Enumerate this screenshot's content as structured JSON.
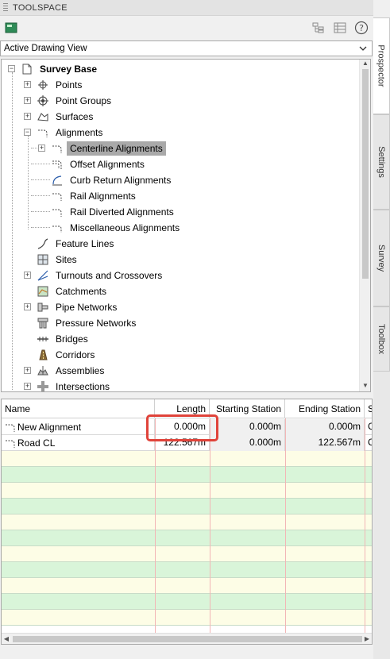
{
  "window": {
    "title": "TOOLSPACE"
  },
  "toolbar": {
    "left_icon": "prospector-icon",
    "right_icons": [
      "item-view-icon",
      "list-view-icon",
      "help-icon"
    ]
  },
  "view_selector": {
    "value": "Active Drawing View"
  },
  "tree": {
    "root": "Survey Base",
    "items": [
      {
        "label": "Points",
        "icon": "points-icon"
      },
      {
        "label": "Point Groups",
        "icon": "point-groups-icon"
      },
      {
        "label": "Surfaces",
        "icon": "surfaces-icon"
      },
      {
        "label": "Alignments",
        "icon": "alignments-icon"
      },
      {
        "label": "Centerline Alignments",
        "icon": "centerline-alignment-icon"
      },
      {
        "label": "Offset Alignments",
        "icon": "offset-alignment-icon"
      },
      {
        "label": "Curb Return Alignments",
        "icon": "curb-return-alignment-icon"
      },
      {
        "label": "Rail Alignments",
        "icon": "rail-alignment-icon"
      },
      {
        "label": "Rail Diverted Alignments",
        "icon": "rail-diverted-alignment-icon"
      },
      {
        "label": "Miscellaneous Alignments",
        "icon": "misc-alignment-icon"
      },
      {
        "label": "Feature Lines",
        "icon": "feature-lines-icon"
      },
      {
        "label": "Sites",
        "icon": "sites-icon"
      },
      {
        "label": "Turnouts and Crossovers",
        "icon": "turnouts-icon"
      },
      {
        "label": "Catchments",
        "icon": "catchments-icon"
      },
      {
        "label": "Pipe Networks",
        "icon": "pipe-networks-icon"
      },
      {
        "label": "Pressure Networks",
        "icon": "pressure-networks-icon"
      },
      {
        "label": "Bridges",
        "icon": "bridges-icon"
      },
      {
        "label": "Corridors",
        "icon": "corridors-icon"
      },
      {
        "label": "Assemblies",
        "icon": "assemblies-icon"
      },
      {
        "label": "Intersections",
        "icon": "intersections-icon"
      }
    ],
    "selected": "Centerline Alignments"
  },
  "grid": {
    "columns": [
      "Name",
      "Length",
      "Starting Station",
      "Ending Station",
      "S"
    ],
    "rows": [
      {
        "name": "New Alignment",
        "length": "0.000m",
        "start": "0.000m",
        "end": "0.000m",
        "s": "C"
      },
      {
        "name": "Road CL",
        "length": "122.567m",
        "start": "0.000m",
        "end": "122.567m",
        "s": "C"
      }
    ],
    "highlighted_cell": "New Alignment / Length"
  },
  "side_tabs": [
    "Prospector",
    "Settings",
    "Survey",
    "Toolbox"
  ],
  "active_side_tab": "Prospector",
  "colors": {
    "highlight_box": "#e0433a",
    "empty_row_yellow": "#fdfde6",
    "empty_row_green": "#d9f5d9",
    "selection": "#a9a9a9"
  }
}
